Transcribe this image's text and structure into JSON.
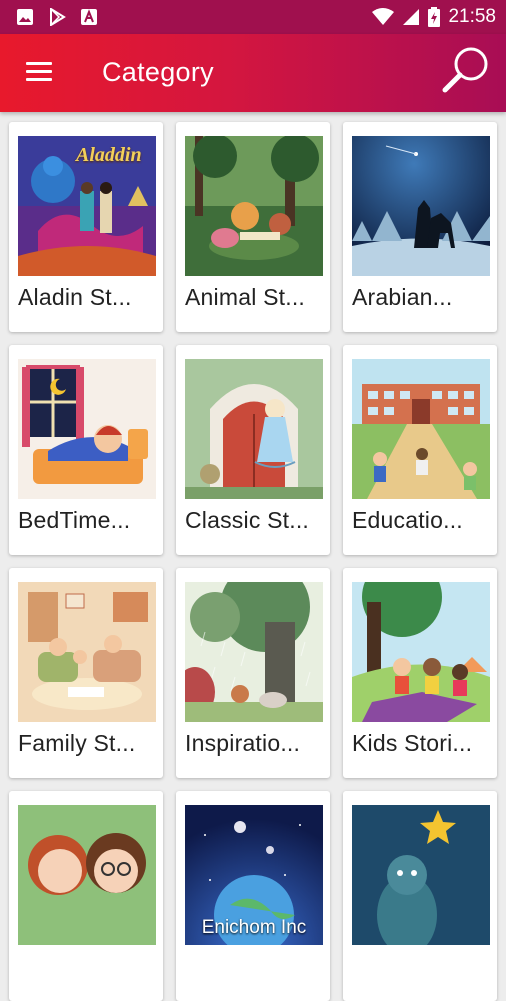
{
  "status_bar": {
    "time": "21:58"
  },
  "app_bar": {
    "title": "Category"
  },
  "categories": [
    {
      "label": "Aladin St...",
      "image": "aladdin-cover",
      "cover_title": "Aladdin"
    },
    {
      "label": "Animal St...",
      "image": "animal-forest"
    },
    {
      "label": "Arabian...",
      "image": "arabian-night"
    },
    {
      "label": "BedTime...",
      "image": "bedtime-child"
    },
    {
      "label": "Classic St...",
      "image": "classic-door"
    },
    {
      "label": "Educatio...",
      "image": "school-kids"
    },
    {
      "label": "Family St...",
      "image": "family-room"
    },
    {
      "label": "Inspiratio...",
      "image": "rain-tree"
    },
    {
      "label": "Kids Stori...",
      "image": "kids-park"
    },
    {
      "label": "",
      "image": "couple-portrait"
    },
    {
      "label": "",
      "image": "space-earth",
      "watermark": "Enichom Inc"
    },
    {
      "label": "",
      "image": "star-child"
    }
  ],
  "colors": {
    "status_bar": "#a0104e",
    "app_bar_start": "#e8192c",
    "app_bar_end": "#a80d55",
    "background": "#ededed"
  }
}
